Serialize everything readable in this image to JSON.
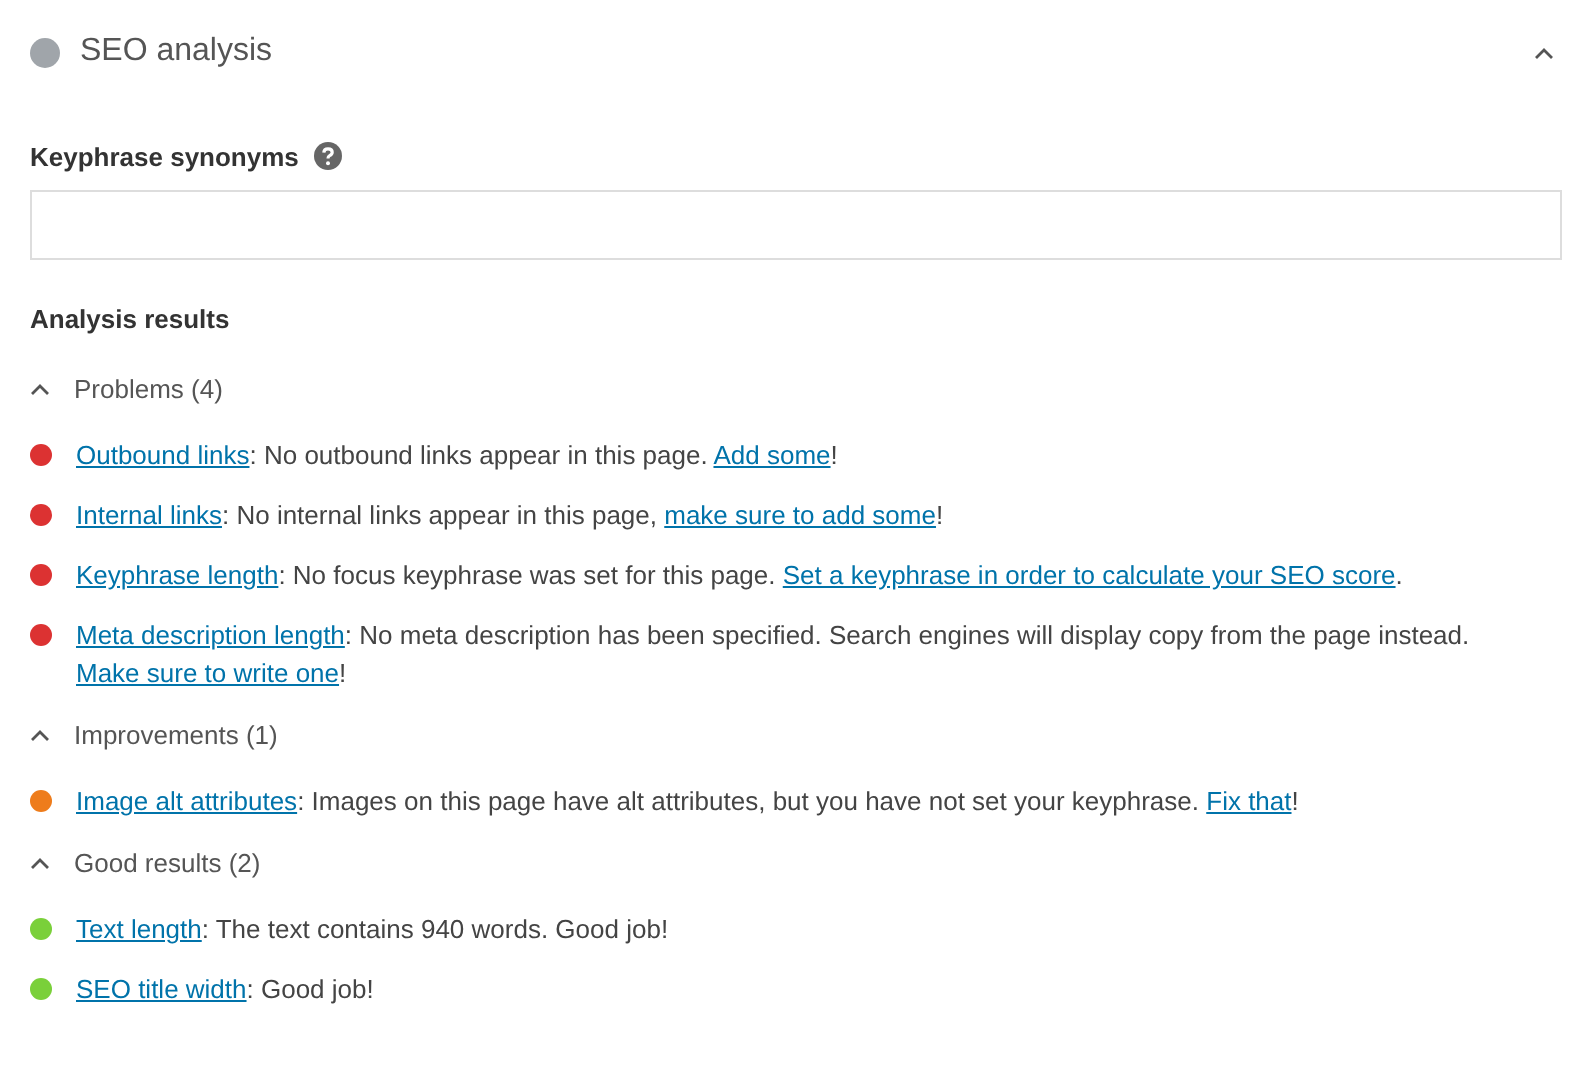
{
  "panel": {
    "title": "SEO analysis",
    "expanded": true
  },
  "synonyms": {
    "label": "Keyphrase synonyms"
  },
  "results_heading": "Analysis results",
  "groups": [
    {
      "title": "Problems (4)",
      "expanded": true,
      "items": [
        {
          "color": "#dc3232",
          "parts": [
            {
              "kind": "link",
              "text": "Outbound links"
            },
            {
              "kind": "text",
              "text": ": No outbound links appear in this page. "
            },
            {
              "kind": "link",
              "text": "Add some"
            },
            {
              "kind": "text",
              "text": "!"
            }
          ]
        },
        {
          "color": "#dc3232",
          "parts": [
            {
              "kind": "link",
              "text": "Internal links"
            },
            {
              "kind": "text",
              "text": ": No internal links appear in this page, "
            },
            {
              "kind": "link",
              "text": "make sure to add some"
            },
            {
              "kind": "text",
              "text": "!"
            }
          ]
        },
        {
          "color": "#dc3232",
          "parts": [
            {
              "kind": "link",
              "text": "Keyphrase length"
            },
            {
              "kind": "text",
              "text": ": No focus keyphrase was set for this page. "
            },
            {
              "kind": "link",
              "text": "Set a keyphrase in order to calculate your SEO score"
            },
            {
              "kind": "text",
              "text": "."
            }
          ]
        },
        {
          "color": "#dc3232",
          "parts": [
            {
              "kind": "link",
              "text": "Meta description length"
            },
            {
              "kind": "text",
              "text": ": No meta description has been specified. Search engines will display copy from the page instead. "
            },
            {
              "kind": "link",
              "text": "Make sure to write one"
            },
            {
              "kind": "text",
              "text": "!"
            }
          ]
        }
      ]
    },
    {
      "title": "Improvements (1)",
      "expanded": true,
      "items": [
        {
          "color": "#ee7c1b",
          "parts": [
            {
              "kind": "link",
              "text": "Image alt attributes"
            },
            {
              "kind": "text",
              "text": ": Images on this page have alt attributes, but you have not set your keyphrase. "
            },
            {
              "kind": "link",
              "text": "Fix that"
            },
            {
              "kind": "text",
              "text": "!"
            }
          ]
        }
      ]
    },
    {
      "title": "Good results (2)",
      "expanded": true,
      "items": [
        {
          "color": "#7ad03a",
          "parts": [
            {
              "kind": "link",
              "text": "Text length"
            },
            {
              "kind": "text",
              "text": ": The text contains 940 words. Good job!"
            }
          ]
        },
        {
          "color": "#7ad03a",
          "parts": [
            {
              "kind": "link",
              "text": "SEO title width"
            },
            {
              "kind": "text",
              "text": ": Good job!"
            }
          ]
        }
      ]
    }
  ]
}
